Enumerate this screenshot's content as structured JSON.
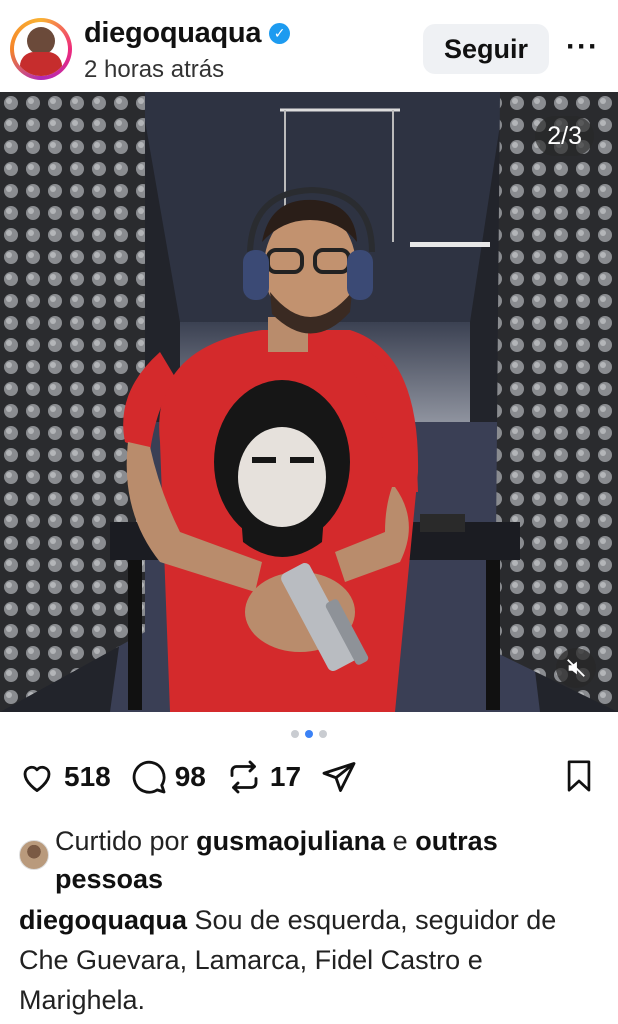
{
  "post": {
    "username": "diegoquaqua",
    "verified_mark": "✓",
    "time_ago": "2 horas atrás",
    "follow_label": "Seguir",
    "more_label": "···"
  },
  "media": {
    "counter": "2/3",
    "current_slide": 2,
    "total_slides": 3,
    "mute_icon": "speaker-muted-icon"
  },
  "actions": {
    "likes": "518",
    "comments": "98",
    "reposts": "17",
    "icons": [
      "heart-icon",
      "comment-icon",
      "repost-icon",
      "share-icon",
      "bookmark-icon"
    ]
  },
  "liked_by": {
    "prefix": "Curtido por",
    "user": "gusmaojuliana",
    "joiner": "e",
    "others": "outras pessoas"
  },
  "caption": {
    "author": "diegoquaqua",
    "text": "Sou de esquerda, seguidor de Che Guevara, Lamarca, Fidel Castro e Marighela."
  },
  "colors": {
    "verified": "#1d9bf0",
    "active_dot": "#3b82f6",
    "inactive_dot": "#c9ccd1",
    "follow_bg": "#eff1f4",
    "shirt_red": "#d42a2c"
  }
}
